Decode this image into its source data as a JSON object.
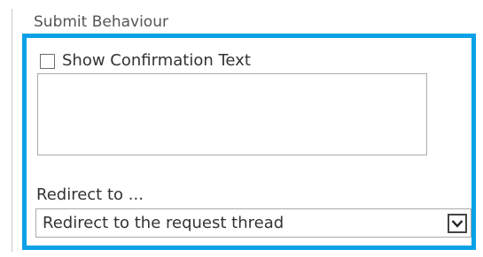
{
  "section": {
    "title": "Submit Behaviour"
  },
  "confirmation": {
    "checkbox_label": "Show Confirmation Text",
    "checked": false,
    "text_value": ""
  },
  "redirect": {
    "label": "Redirect to ...",
    "selected": "Redirect to the request thread",
    "dropdown_icon": "chevron-down-icon"
  },
  "colors": {
    "highlight_border": "#0aa1e6"
  }
}
